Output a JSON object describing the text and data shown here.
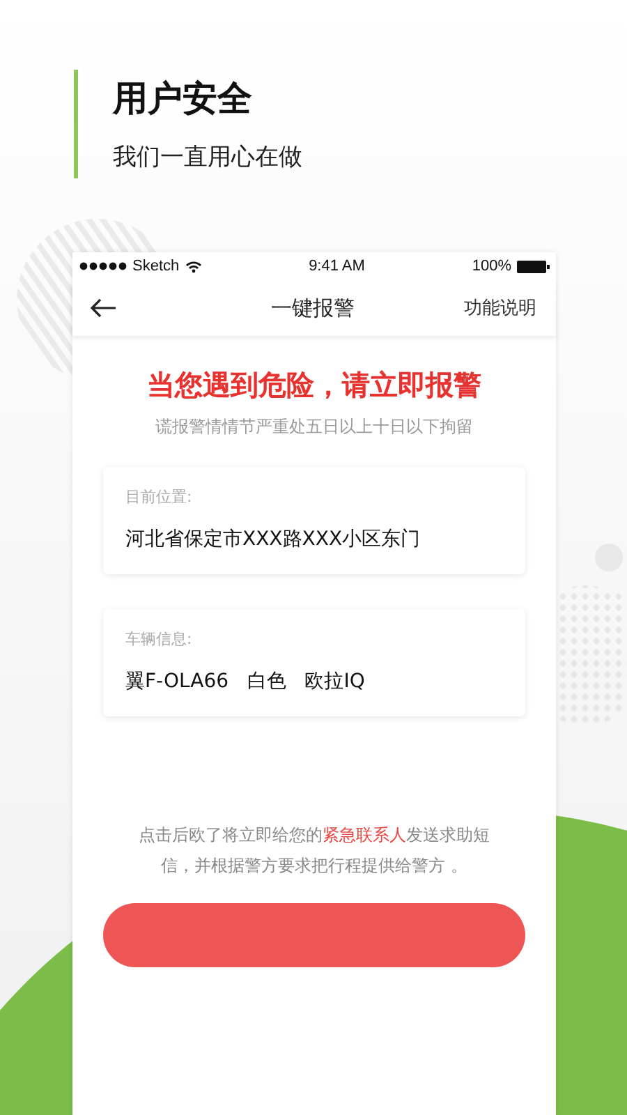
{
  "header": {
    "title": "用户安全",
    "subtitle": "我们一直用心在做"
  },
  "status_bar": {
    "carrier": "Sketch",
    "time": "9:41 AM",
    "battery": "100%"
  },
  "nav": {
    "title": "一键报警",
    "action": "功能说明"
  },
  "alert": {
    "headline": "当您遇到危险，请立即报警",
    "warning": "谎报警情情节严重处五日以上十日以下拘留"
  },
  "cards": [
    {
      "label": "目前位置:",
      "value": "河北省保定市XXX路XXX小区东门"
    },
    {
      "label": "车辆信息:",
      "value": "翼F-OLA66   白色   欧拉IQ"
    }
  ],
  "note": "点击后欧了将立即给您的**紧急联系人**发送求助短信，并根据警方要求把行程提供给警方 。"
}
